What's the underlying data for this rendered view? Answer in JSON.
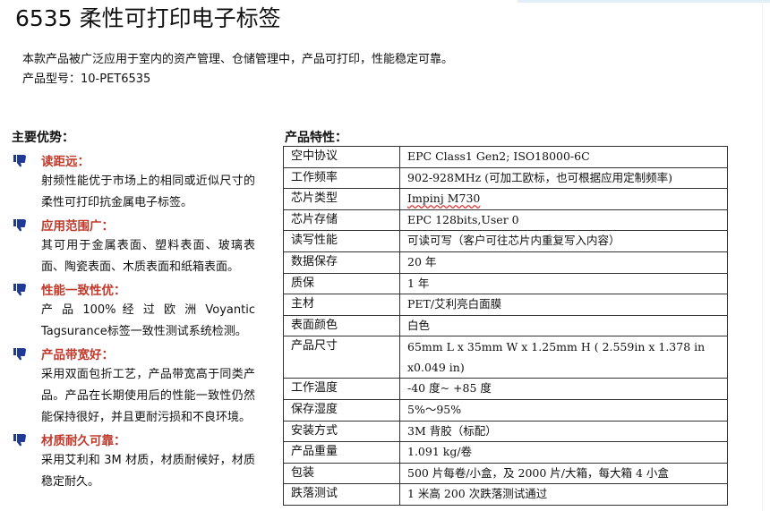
{
  "title": "6535 柔性可打印电子标签",
  "intro": [
    "本款产品被广泛应用于室内的资产管理、仓储管理中，产品可打印，性能稳定可靠。",
    "产品型号：10-PET6535"
  ],
  "advantages": {
    "heading": "主要优势：",
    "items": [
      {
        "label": "读距远：",
        "desc": "射频性能优于市场上的相同或近似尺寸的柔性可打印抗金属电子标签。"
      },
      {
        "label": "应用范围广：",
        "desc": "其可用于金属表面、塑料表面、玻璃表面、陶瓷表面、木质表面和纸箱表面。"
      },
      {
        "label": "性能一致性优：",
        "desc": "产 品 100% 经 过 欧 洲 Voyantic Tagsurance标签一致性测试系统检测。"
      },
      {
        "label": "产品带宽好：",
        "desc": "采用双面包折工艺，产品带宽高于同类产品。产品在长期使用后的性能一致性仍然能保持很好，并且更耐污损和不良环境。"
      },
      {
        "label": "材质耐久可靠：",
        "desc": "采用艾利和 3M 材质，材质耐候好，材质稳定耐久。"
      }
    ]
  },
  "specs": {
    "heading": "产品特性：",
    "rows": [
      {
        "key": "空中协议",
        "value": "EPC Class1 Gen2; ISO18000-6C"
      },
      {
        "key": "工作频率",
        "value": "902-928MHz  (可加工欧标，也可根据应用定制频率)"
      },
      {
        "key": "芯片类型",
        "value": "Impinj M730"
      },
      {
        "key": "芯片存储",
        "value": "EPC 128bits,User 0"
      },
      {
        "key": "读写性能",
        "value": "可读可写（客户可往芯片内重复写入内容）"
      },
      {
        "key": "数据保存",
        "value": "20 年"
      },
      {
        "key": "质保",
        "value": "1 年"
      },
      {
        "key": "主材",
        "value": "PET/艾利亮白面膜"
      },
      {
        "key": "表面颜色",
        "value": "白色"
      },
      {
        "key": "产品尺寸",
        "value": "65mm L x 35mm W x 1.25mm H ( 2.559in x 1.378 in x0.049 in)"
      },
      {
        "key": "工作温度",
        "value": "-40 度~ +85 度"
      },
      {
        "key": "保存湿度",
        "value": "5%～95%"
      },
      {
        "key": "安装方式",
        "value": "3M 背胶（标配）"
      },
      {
        "key": "产品重量",
        "value": "1.091 kg/卷"
      },
      {
        "key": "包装",
        "value": "500 片每卷/小盒，及 2000 片/大箱，每大箱 4 小盒"
      },
      {
        "key": "跌落测试",
        "value": "1 米高 200 次跌落测试通过"
      }
    ]
  },
  "icons": {
    "bullet": "thumbs-down-hand-icon",
    "bullet_color": "#1f3a93",
    "accent_red": "#c0392b"
  }
}
